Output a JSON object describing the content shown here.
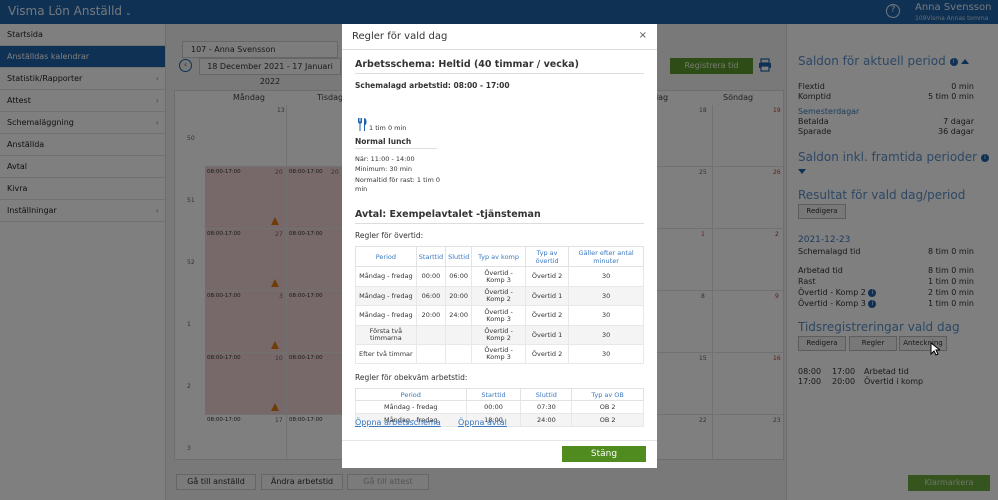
{
  "app": {
    "title": "Visma Lön Anställd",
    "user_name": "Anna Svensson",
    "user_sub": "109Visma Annas tomma"
  },
  "sidebar": {
    "items": [
      {
        "label": "Startsida",
        "chevron": false
      },
      {
        "label": "Anställdas kalendrar",
        "chevron": false,
        "active": true
      },
      {
        "label": "Statistik/Rapporter",
        "chevron": true
      },
      {
        "label": "Attest",
        "chevron": true
      },
      {
        "label": "Schemaläggning",
        "chevron": true
      },
      {
        "label": "Anställda",
        "chevron": false
      },
      {
        "label": "Avtal",
        "chevron": false
      },
      {
        "label": "Kivra",
        "chevron": false
      },
      {
        "label": "Inställningar",
        "chevron": true
      }
    ]
  },
  "calendar": {
    "employee": "107 - Anna Svensson",
    "date_range": "18 December 2021 - 17 Januari 2022",
    "register_button": "Registrera tid",
    "days": [
      "Måndag",
      "Tisdag",
      "",
      "",
      "",
      "dag",
      "Söndag"
    ],
    "weeks": [
      "50",
      "51",
      "52",
      "1",
      "2",
      "3"
    ],
    "schedule_text": "08:00-17:00",
    "date_numbers": {
      "mon": [
        "13",
        "20",
        "27",
        "3",
        "10",
        "17"
      ],
      "tue": [
        "",
        "20",
        "",
        "",
        "",
        ""
      ],
      "sat": [
        "18",
        "25",
        "1",
        "8",
        "15",
        "22"
      ],
      "sun": [
        "19",
        "26",
        "2",
        "9",
        "16",
        "23"
      ]
    }
  },
  "bottom": {
    "go_to_employee": "Gå till anställd",
    "change_schedule": "Ändra arbetstid",
    "go_to_attest": "Gå till attest",
    "mark_done": "Klarmarkera"
  },
  "right": {
    "saldon_title": "Saldon för aktuell period",
    "saldon": [
      {
        "label": "Flextid",
        "value": "0 min"
      },
      {
        "label": "Komptid",
        "value": "5 tim 0 min"
      }
    ],
    "semester_link": "Semesterdagar",
    "semester": [
      {
        "label": "Betalda",
        "value": "7 dagar"
      },
      {
        "label": "Sparade",
        "value": "36 dagar"
      }
    ],
    "saldon_future_title": "Saldon inkl. framtida perioder",
    "result_title": "Resultat för vald dag/period",
    "edit_label": "Redigera",
    "date_link": "2021-12-23",
    "scheduled": {
      "label": "Schemalagd tid",
      "value": "8 tim 0 min"
    },
    "result": [
      {
        "label": "Arbetad tid",
        "value": "8 tim 0 min",
        "info": false
      },
      {
        "label": "Rast",
        "value": "1 tim 0 min",
        "info": false
      },
      {
        "label": "Övertid - Komp 2",
        "value": "2 tim 0 min",
        "info": true
      },
      {
        "label": "Övertid - Komp 3",
        "value": "1 tim 0 min",
        "info": true
      }
    ],
    "timereg_title": "Tidsregistreringar vald dag",
    "timereg_buttons": [
      "Redigera",
      "Regler",
      "Anteckning"
    ],
    "timereg": [
      {
        "start": "08:00",
        "end": "17:00",
        "type": "Arbetad tid"
      },
      {
        "start": "17:00",
        "end": "20:00",
        "type": "Övertid i komp"
      }
    ]
  },
  "modal": {
    "title": "Regler för vald dag",
    "close": "×",
    "schedule_heading": "Arbetsschema: Heltid (40 timmar / vecka)",
    "scheduled_time": "Schemalagd arbetstid: 08:00 - 17:00",
    "lunch_duration": "1 tim 0 min",
    "lunch_title": "Normal lunch",
    "lunch_when": "När: 11:00 - 14:00",
    "lunch_min": "Minimum: 30 min",
    "lunch_norm_1": "Normaltid för rast: 1 tim 0",
    "lunch_norm_2": "min",
    "agreement_heading": "Avtal: Exempelavtalet -tjänsteman",
    "overtime_rules_label": "Regler för övertid:",
    "overtime_headers": [
      "Period",
      "Starttid",
      "Sluttid",
      "Typ av komp",
      "Typ av övertid",
      "Gäller efter antal minuter"
    ],
    "overtime_rows": [
      [
        "Måndag - fredag",
        "00:00",
        "06:00",
        "Övertid - Komp 3",
        "Övertid 2",
        "30"
      ],
      [
        "Måndag - fredag",
        "06:00",
        "20:00",
        "Övertid - Komp 2",
        "Övertid 1",
        "30"
      ],
      [
        "Måndag - fredag",
        "20:00",
        "24:00",
        "Övertid - Komp 3",
        "Övertid 2",
        "30"
      ],
      [
        "Första två timmarna",
        "",
        "",
        "Övertid - Komp 2",
        "Övertid 1",
        "30"
      ],
      [
        "Efter två timmar",
        "",
        "",
        "Övertid - Komp 3",
        "Övertid 2",
        "30"
      ]
    ],
    "ob_rules_label": "Regler för obekväm arbetstid:",
    "ob_headers": [
      "Period",
      "Starttid",
      "Sluttid",
      "Typ av OB"
    ],
    "ob_rows": [
      [
        "Måndag - fredag",
        "00:00",
        "07:30",
        "OB 2"
      ],
      [
        "Måndag - fredag",
        "18:00",
        "24:00",
        "OB 2"
      ]
    ],
    "open_schedule_link": "Öppna arbetsschema",
    "open_agreement_link": "Öppna avtal",
    "close_button": "Stäng"
  },
  "colors": {
    "brand": "#1e63a8",
    "green": "#4f8b1e",
    "warning": "#e07b12",
    "holiday_red": "#c0392b",
    "link": "#3a78c0"
  },
  "icons": [
    "chevron-down-icon",
    "help-icon",
    "chevron-right-icon",
    "chevron-left-icon",
    "printer-icon",
    "warning-icon",
    "info-icon",
    "caret-up-icon",
    "caret-down-icon",
    "fork-knife-icon",
    "close-icon",
    "mouse-cursor-icon"
  ]
}
